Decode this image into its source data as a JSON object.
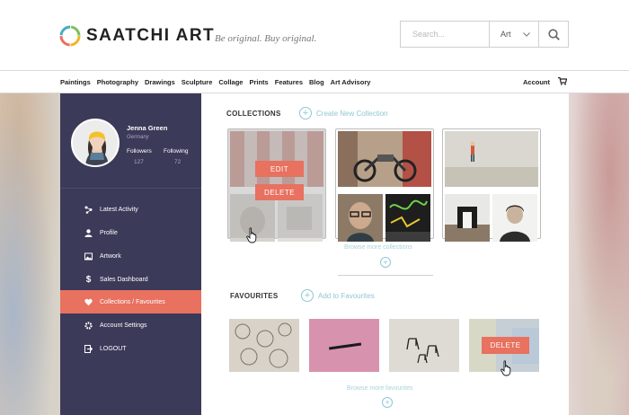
{
  "header": {
    "brand": "SAATCHI ART",
    "tagline": "Be original. Buy original.",
    "search": {
      "placeholder": "Search...",
      "category": "Art"
    }
  },
  "nav": {
    "items": [
      "Paintings",
      "Photography",
      "Drawings",
      "Sculpture",
      "Collage",
      "Prints",
      "Features",
      "Blog",
      "Art Advisory"
    ],
    "account": "Account"
  },
  "profile": {
    "name": "Jenna Green",
    "country": "Germany",
    "followers_label": "Followers",
    "followers_count": "127",
    "following_label": "Following",
    "following_count": "72"
  },
  "sidebar": {
    "items": [
      {
        "label": "Latest Activity",
        "icon": "activity-icon"
      },
      {
        "label": "Profile",
        "icon": "user-icon"
      },
      {
        "label": "Artwork",
        "icon": "image-icon"
      },
      {
        "label": "Sales Dashboard",
        "icon": "dollar-icon"
      },
      {
        "label": "Collections / Favourites",
        "icon": "heart-icon",
        "active": true
      },
      {
        "label": "Account Settings",
        "icon": "gear-icon"
      },
      {
        "label": "LOGOUT",
        "icon": "logout-icon"
      }
    ]
  },
  "collections": {
    "title": "COLLECTIONS",
    "create_label": "Create New Collection",
    "edit_label": "EDIT",
    "delete_label": "DELETE",
    "browse_more": "Browse more collections"
  },
  "favourites": {
    "title": "FAVOURITES",
    "add_label": "Add to Favourites",
    "delete_label": "DELETE",
    "browse_more": "Browse more favourites"
  },
  "colors": {
    "accent": "#e8715f",
    "sidebar": "#3c3a59",
    "link": "#8fc6d3"
  }
}
